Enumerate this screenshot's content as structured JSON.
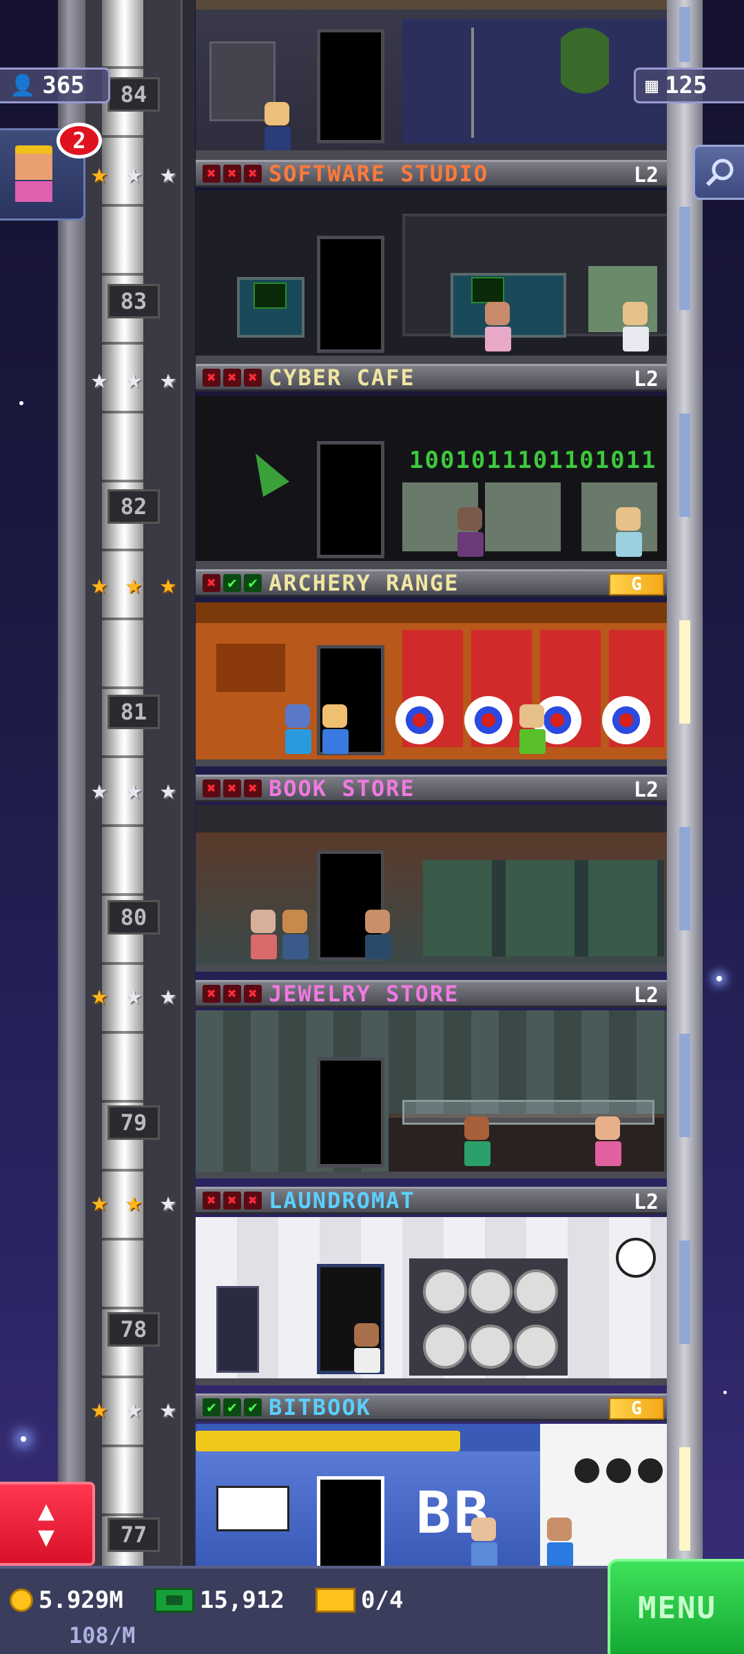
{
  "hud": {
    "population": "365",
    "floors": "125",
    "notification_count": "2"
  },
  "floors": [
    {
      "number": "84",
      "name": "SOFTWARE STUDIO",
      "level": "L2",
      "marks": [
        "x",
        "x",
        "x"
      ],
      "stars": [
        "gold",
        "silver",
        "silver"
      ],
      "name_color": "#ff7a3a",
      "gold": false
    },
    {
      "number": "83",
      "name": "CYBER CAFE",
      "level": "L2",
      "marks": [
        "x",
        "x",
        "x"
      ],
      "stars": [
        "silver",
        "silver",
        "silver"
      ],
      "name_color": "#f0e6a0",
      "gold": false
    },
    {
      "number": "82",
      "name": "ARCHERY RANGE",
      "level": "G",
      "marks": [
        "x",
        "c",
        "c"
      ],
      "stars": [
        "gold",
        "gold",
        "gold"
      ],
      "name_color": "#f0e6a0",
      "gold": true
    },
    {
      "number": "81",
      "name": "BOOK STORE",
      "level": "L2",
      "marks": [
        "x",
        "x",
        "x"
      ],
      "stars": [
        "silver",
        "silver",
        "silver"
      ],
      "name_color": "#f07ae0",
      "gold": false
    },
    {
      "number": "80",
      "name": "JEWELRY STORE",
      "level": "L2",
      "marks": [
        "x",
        "x",
        "x"
      ],
      "stars": [
        "gold",
        "silver",
        "silver"
      ],
      "name_color": "#f07ae0",
      "gold": false
    },
    {
      "number": "79",
      "name": "LAUNDROMAT",
      "level": "L2",
      "marks": [
        "x",
        "x",
        "x"
      ],
      "stars": [
        "gold",
        "gold",
        "silver"
      ],
      "name_color": "#5ad0ff",
      "gold": false
    },
    {
      "number": "78",
      "name": "BITBOOK",
      "level": "G",
      "marks": [
        "c",
        "c",
        "c"
      ],
      "stars": [
        "gold",
        "silver",
        "silver"
      ],
      "name_color": "#5ad0ff",
      "gold": true
    },
    {
      "number": "77"
    }
  ],
  "room_texts": {
    "binary": "1001011101101011",
    "bitbook_logo": "BB"
  },
  "bottom": {
    "coins": "5.929M",
    "bux": "15,912",
    "tickets": "0/4",
    "income": "108/M",
    "menu_label": "MENU"
  }
}
